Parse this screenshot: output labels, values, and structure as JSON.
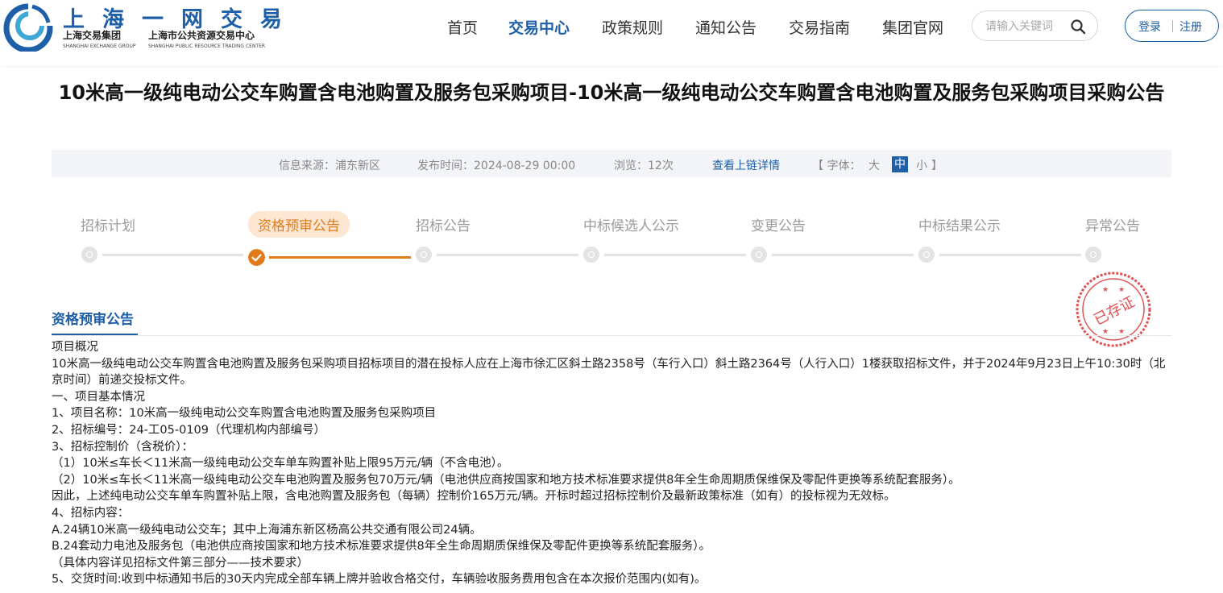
{
  "header": {
    "logo_title": "上海一网交易",
    "logo_org1": "上海交易集团",
    "logo_org2": "上海市公共资源交易中心",
    "logo_org1_en": "SHANGHAI EXCHANGE GROUP",
    "logo_org2_en": "SHANGHAI PUBLIC RESOURCE TRADING CENTER",
    "nav": [
      "首页",
      "交易中心",
      "政策规则",
      "通知公告",
      "交易指南",
      "集团官网"
    ],
    "active_nav": "交易中心",
    "search_placeholder": "请输入关键词",
    "login": "登录",
    "register": "注册",
    "brand_color": "#1e5fa8"
  },
  "title": "10米高一级纯电动公交车购置含电池购置及服务包采购项目-10米高一级纯电动公交车购置含电池购置及服务包采购项目采购公告",
  "info": {
    "source": "信息来源：浦东新区",
    "publish_time": "发布时间：2024-08-29 00:00",
    "views": "浏览：12次",
    "chain_link": "查看上链详情",
    "font_label": "【 字体：",
    "font_large": "大",
    "font_medium": "中",
    "font_small": "小",
    "font_close": "】"
  },
  "steps": [
    {
      "label": "招标计划",
      "active": false
    },
    {
      "label": "资格预审公告",
      "active": true
    },
    {
      "label": "招标公告",
      "active": false
    },
    {
      "label": "中标候选人公示",
      "active": false
    },
    {
      "label": "变更公告",
      "active": false
    },
    {
      "label": "中标结果公示",
      "active": false
    },
    {
      "label": "异常公告",
      "active": false
    }
  ],
  "stamp_text": "已存证",
  "section_title": "资格预审公告",
  "content": [
    "项目概况",
    "10米高一级纯电动公交车购置含电池购置及服务包采购项目招标项目的潜在投标人应在上海市徐汇区斜土路2358号（车行入口）斜土路2364号（人行入口）1楼获取招标文件，并于2024年9月23日上午10:30时（北京时间）前递交投标文件。",
    "一、项目基本情况",
    "1、项目名称：10米高一级纯电动公交车购置含电池购置及服务包采购项目",
    "2、招标编号：24-工05-0109（代理机构内部编号）",
    "3、招标控制价（含税价）：",
    "（1）10米≤车长＜11米高一级纯电动公交车单车购置补贴上限95万元/辆（不含电池）。",
    "（2）10米≤车长＜11米高一级纯电动公交车电池购置及服务包70万元/辆（电池供应商按国家和地方技术标准要求提供8年全生命周期质保维保及零配件更换等系统配套服务）。",
    "因此，上述纯电动公交车单车购置补贴上限，含电池购置及服务包（每辆）控制价165万元/辆。开标时超过招标控制价及最新政策标准（如有）的投标视为无效标。",
    "4、招标内容：",
    "A.24辆10米高一级纯电动公交车；其中上海浦东新区杨高公共交通有限公司24辆。",
    "B.24套动力电池及服务包（电池供应商按国家和地方技术标准要求提供8年全生命周期质保维保及零配件更换等系统配套服务）。",
    "（具体内容详见招标文件第三部分——技术要求）",
    "5、交货时间:收到中标通知书后的30天内完成全部车辆上牌并验收合格交付，车辆验收服务费用包含在本次报价范围内(如有)。"
  ]
}
